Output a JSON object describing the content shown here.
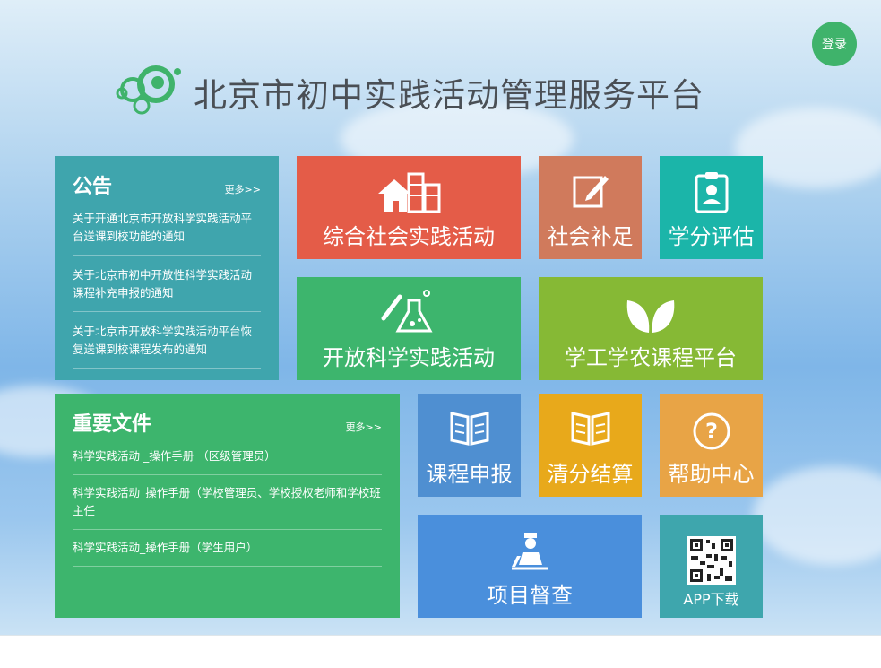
{
  "header": {
    "title": "北京市初中实践活动管理服务平台",
    "login_label": "登录"
  },
  "notice": {
    "title": "公告",
    "more": "更多>>",
    "items": [
      "关于开通北京市开放科学实践活动平台送课到校功能的通知",
      "关于北京市初中开放性科学实践活动课程补充申报的通知",
      "关于北京市开放科学实践活动平台恢复送课到校课程发布的通知"
    ]
  },
  "docs": {
    "title": "重要文件",
    "more": "更多>>",
    "items": [
      "科学实践活动 _操作手册 （区级管理员）",
      "科学实践活动_操作手册（学校管理员、学校授权老师和学校班主任",
      "科学实践活动_操作手册（学生用户）"
    ]
  },
  "tiles": {
    "social": {
      "label": "综合社会实践活动",
      "icon": "buildings-icon",
      "color": "#e45c48"
    },
    "makeup": {
      "label": "社会补足",
      "icon": "edit-icon",
      "color": "#d07a5c"
    },
    "credit": {
      "label": "学分评估",
      "icon": "clipboard-user-icon",
      "color": "#1bb5a9"
    },
    "science": {
      "label": "开放科学实践活动",
      "icon": "flask-icon",
      "color": "#3db56d"
    },
    "farm": {
      "label": "学工学农课程平台",
      "icon": "leaves-icon",
      "color": "#86b935"
    },
    "apply": {
      "label": "课程申报",
      "icon": "book-icon",
      "color": "#4f8fd1"
    },
    "settle": {
      "label": "清分结算",
      "icon": "book-icon",
      "color": "#e8a91b"
    },
    "help": {
      "label": "帮助中心",
      "icon": "question-icon",
      "color": "#e8a446"
    },
    "inspect": {
      "label": "项目督查",
      "icon": "inspector-icon",
      "color": "#4a8fdc"
    },
    "app": {
      "label": "APP下载",
      "icon": "qr-code-icon",
      "color": "#3ea6ad"
    }
  }
}
